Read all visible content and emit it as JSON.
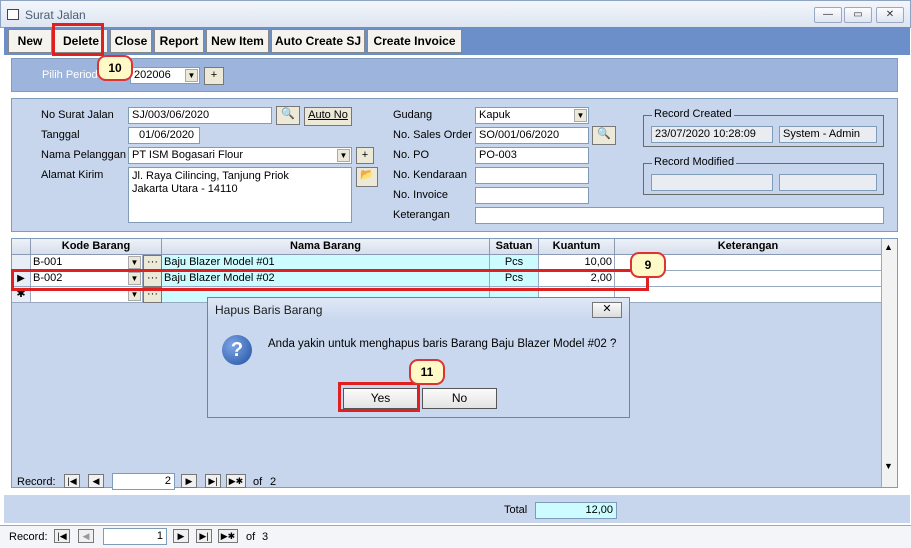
{
  "window": {
    "title": "Surat Jalan"
  },
  "toolbar": {
    "new": "New",
    "delete": "Delete",
    "close": "Close",
    "report": "Report",
    "new_item": "New Item",
    "auto_create_sj": "Auto Create SJ",
    "create_invoice": "Create Invoice"
  },
  "periode": {
    "label": "Pilih Periode",
    "value": "202006",
    "add": "+"
  },
  "form": {
    "no_surat_jalan_label": "No Surat Jalan",
    "no_surat_jalan": "SJ/003/06/2020",
    "auto_no": "Auto No",
    "tanggal_label": "Tanggal",
    "tanggal": "01/06/2020",
    "nama_pelanggan_label": "Nama Pelanggan",
    "nama_pelanggan": "PT ISM Bogasari Flour",
    "alamat_kirim_label": "Alamat Kirim",
    "alamat_line1": "Jl. Raya Cilincing, Tanjung Priok",
    "alamat_line2": "Jakarta Utara - 14110",
    "gudang_label": "Gudang",
    "gudang": "Kapuk",
    "no_sales_order_label": "No. Sales Order",
    "no_sales_order": "SO/001/06/2020",
    "no_po_label": "No. PO",
    "no_po": "PO-003",
    "no_kendaraan_label": "No. Kendaraan",
    "no_kendaraan": "",
    "no_invoice_label": "No. Invoice",
    "no_invoice": "",
    "keterangan_label": "Keterangan",
    "keterangan": ""
  },
  "record_created": {
    "label": "Record Created",
    "date": "23/07/2020 10:28:09",
    "user": "System - Admin"
  },
  "record_modified": {
    "label": "Record Modified",
    "date": "",
    "user": ""
  },
  "grid": {
    "headers": [
      "Kode Barang",
      "Nama Barang",
      "Satuan",
      "Kuantum",
      "Keterangan"
    ],
    "rows": [
      {
        "kode": "B-001",
        "nama": "Baju Blazer Model #01",
        "satuan": "Pcs",
        "kuantum": "10,00",
        "keterangan": ""
      },
      {
        "kode": "B-002",
        "nama": "Baju Blazer Model #02",
        "satuan": "Pcs",
        "kuantum": "2,00",
        "keterangan": ""
      }
    ],
    "nav": {
      "label": "Record:",
      "current": "2",
      "of": "of",
      "total": "2"
    }
  },
  "dialog": {
    "title": "Hapus Baris Barang",
    "message": "Anda yakin untuk menghapus baris Barang Baju Blazer Model #02 ?",
    "yes": "Yes",
    "no": "No"
  },
  "total": {
    "label": "Total",
    "value": "12,00"
  },
  "main_nav": {
    "label": "Record:",
    "current": "1",
    "of": "of",
    "total": "3"
  },
  "badges": {
    "b9": "9",
    "b10": "10",
    "b11": "11"
  },
  "colors": {
    "toolbar": "#6c8fca",
    "panel": "#c7d6ec",
    "highlight": "#e02020",
    "row_cyan": "#ccfcff"
  }
}
